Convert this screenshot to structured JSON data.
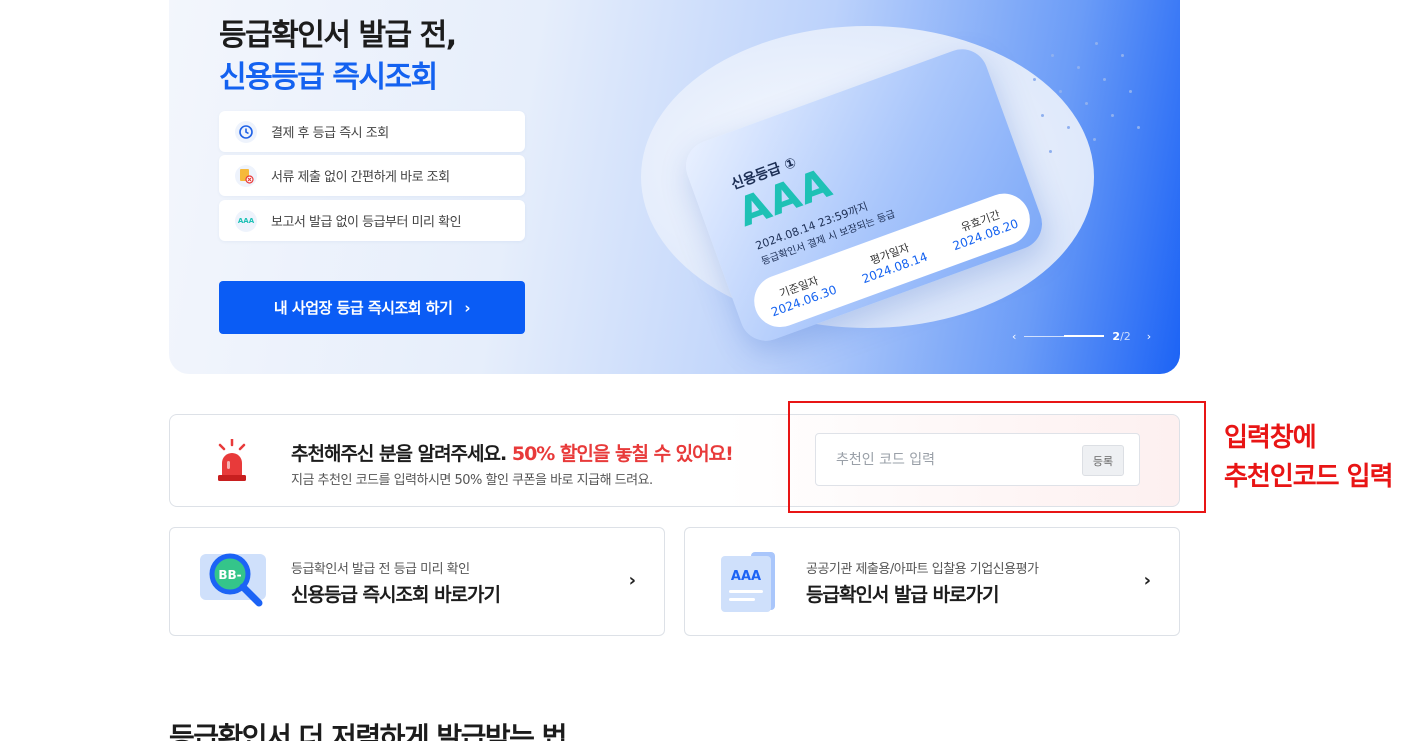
{
  "hero": {
    "title_line1": "등급확인서 발급 전,",
    "title_line2": "신용등급 즉시조회",
    "features": [
      {
        "icon": "clock-icon",
        "icon_text": "⏱",
        "label": "결제 후 등급 즉시 조회"
      },
      {
        "icon": "document-x-icon",
        "icon_text": "📄",
        "label": "서류 제출 없이 간편하게 바로 조회"
      },
      {
        "icon": "aaa-badge-icon",
        "icon_text": "AAA",
        "label": "보고서 발급 없이 등급부터 미리 확인"
      }
    ],
    "cta_label": "내 사업장 등급 즉시조회 하기",
    "card": {
      "caption": "신용등급 ①",
      "grade": "AAA",
      "note1": "2024.08.14 23:59까지",
      "note2": "등급확인서 결제 시 보장되는 등급",
      "cells": [
        {
          "key": "기준일자",
          "value": "2024.06.30"
        },
        {
          "key": "평가일자",
          "value": "2024.08.14"
        },
        {
          "key": "유효기간",
          "value": "2024.08.20"
        }
      ]
    },
    "pager": {
      "current": "2",
      "total": "/2"
    }
  },
  "referral": {
    "title_main": "추천해주신 분을 알려주세요.",
    "title_highlight": "50% 할인을 놓칠 수 있어요!",
    "subtitle": "지금 추천인 코드를 입력하시면 50% 할인 쿠폰을 바로 지급해 드려요.",
    "input_placeholder": "추천인 코드 입력",
    "register_label": "등록",
    "highlight_color": "#e83a3a"
  },
  "annotation": {
    "line1": "입력창에",
    "line2": "추천인코드 입력",
    "color": "#e81515"
  },
  "shortcuts": [
    {
      "icon": "magnifier-grade-icon",
      "badge": "BB-",
      "subtitle": "등급확인서 발급 전 등급 미리 확인",
      "title": "신용등급 즉시조회 바로가기"
    },
    {
      "icon": "certificate-document-icon",
      "badge": "AAA",
      "subtitle": "공공기관 제출용/아파트 입찰용 기업신용평가",
      "title": "등급확인서 발급 바로가기"
    }
  ],
  "next_section_title": "등급확인서 더 저렴하게 발급받는 법",
  "colors": {
    "primary": "#0a5cf5",
    "accent_teal": "#1ec1b5"
  }
}
